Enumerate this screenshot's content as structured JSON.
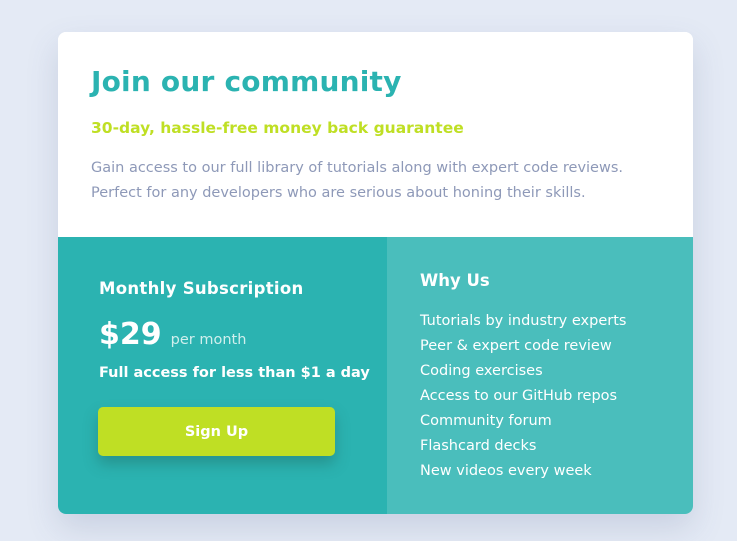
{
  "header": {
    "title": "Join our community",
    "subtitle": "30-day, hassle-free money back guarantee",
    "description_line1": "Gain access to our full library of tutorials along with expert code reviews.",
    "description_line2": "Perfect for any developers who are serious about honing their skills."
  },
  "subscription": {
    "title": "Monthly Subscription",
    "price": "$29",
    "period": "per month",
    "tagline": "Full access for less than $1 a day",
    "button_label": "Sign Up"
  },
  "why_us": {
    "title": "Why Us",
    "items": [
      "Tutorials by industry experts",
      "Peer & expert code review",
      "Coding exercises",
      "Access to our GitHub repos",
      "Community forum",
      "Flashcard decks",
      "New videos every week"
    ]
  },
  "colors": {
    "background": "#e4eaf5",
    "primary_teal": "#2bb3b1",
    "light_teal": "#4abebc",
    "accent_lime": "#bfdf24",
    "text_muted": "#8e99b8"
  }
}
